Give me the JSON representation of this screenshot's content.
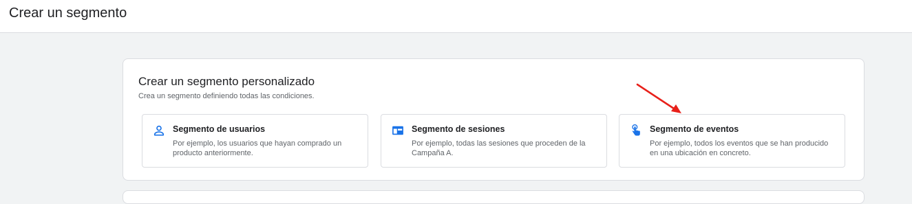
{
  "header": {
    "title": "Crear un segmento"
  },
  "custom_segment": {
    "title": "Crear un segmento personalizado",
    "subtitle": "Crea un segmento definiendo todas las condiciones.",
    "options": [
      {
        "icon": "person-icon",
        "title": "Segmento de usuarios",
        "description": "Por ejemplo, los usuarios que hayan comprado un producto anteriormente."
      },
      {
        "icon": "browser-window-icon",
        "title": "Segmento de sesiones",
        "description": "Por ejemplo, todas las sesiones que proceden de la Campaña A."
      },
      {
        "icon": "touch-hand-icon",
        "title": "Segmento de eventos",
        "description": "Por ejemplo, todos los eventos que se han producido en una ubicación en concreto."
      }
    ]
  },
  "colors": {
    "icon_blue": "#1a73e8",
    "annotation_red": "#e8201a"
  }
}
